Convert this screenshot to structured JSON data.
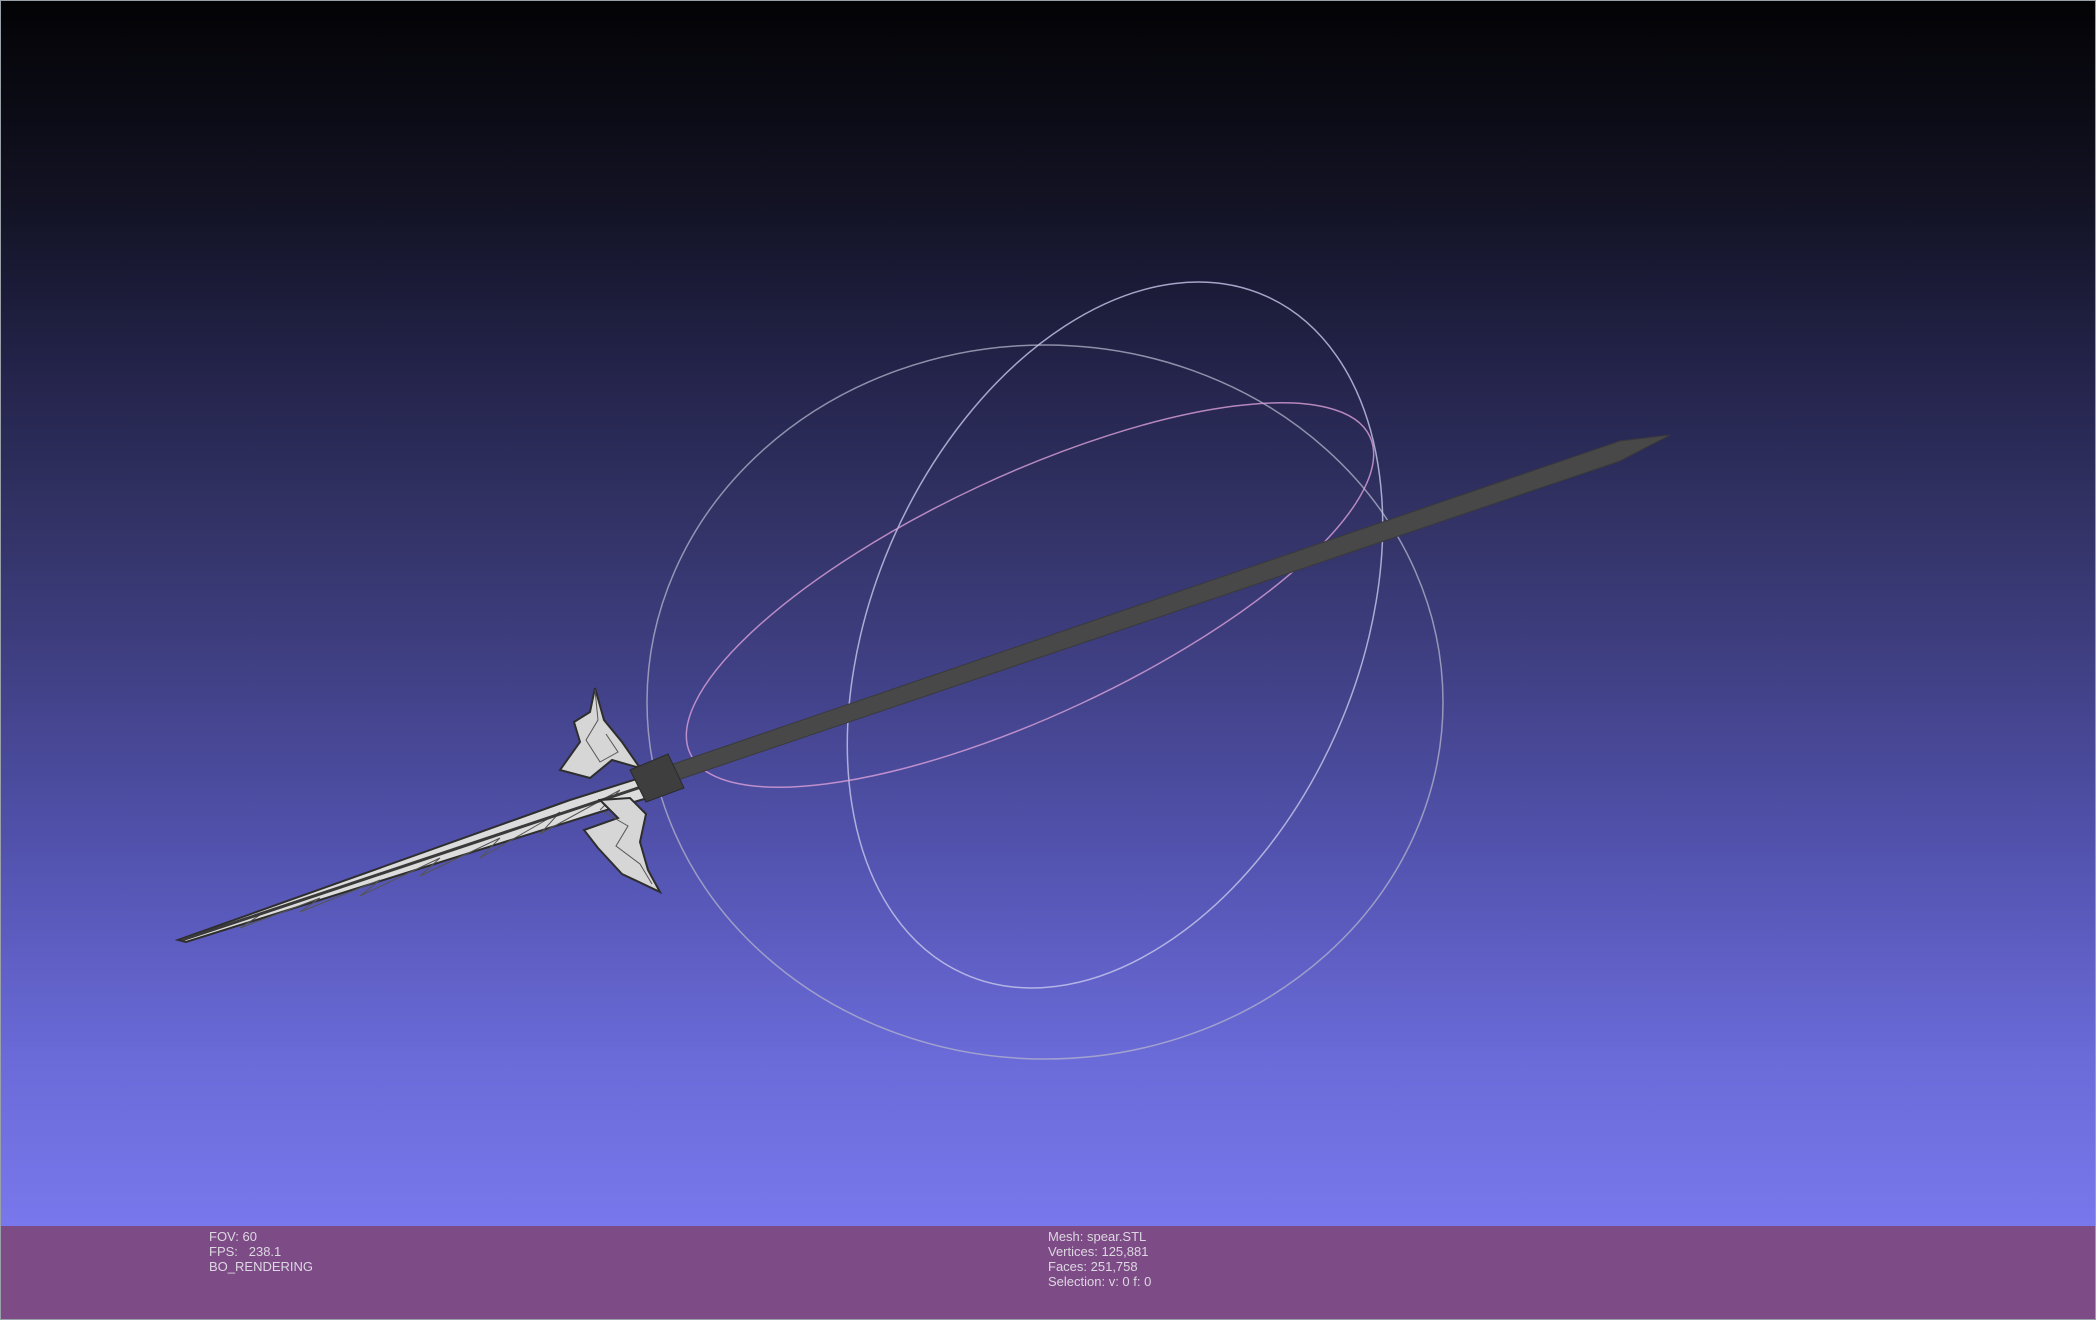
{
  "viewer": {
    "background_top": "#030305",
    "background_bottom": "#7878ec",
    "mesh_color": "#4a4a4a",
    "wire_color": "#e8e8e8",
    "trackball_colors": [
      "#c8c8d0",
      "#d9a0d8",
      "#b8b8e8"
    ]
  },
  "overlay_left": {
    "fov": "FOV: 60",
    "fps": "FPS:   238.1",
    "mode": "BO_RENDERING"
  },
  "overlay_center": {
    "mesh": "Mesh: spear.STL",
    "vertices": "Vertices: 125,881",
    "faces": "Faces: 251,758",
    "selection": "Selection: v: 0 f: 0"
  },
  "status_bar_color": "#7d4b86"
}
